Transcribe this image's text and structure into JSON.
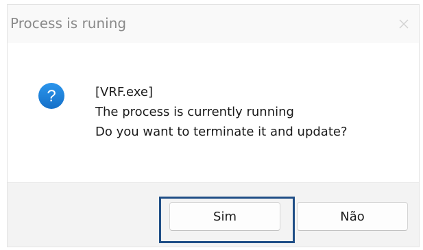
{
  "dialog": {
    "title": "Process is runing",
    "close_icon": "close-icon",
    "icon": "question-icon",
    "icon_glyph": "?",
    "icon_color": "#1b7fd8",
    "message_lines": [
      "[VRF.exe]",
      "The process is currently running",
      "Do you want to terminate it and update?"
    ],
    "buttons": {
      "yes_label": "Sim",
      "no_label": "Não"
    },
    "highlight_color": "#1f4e86"
  }
}
